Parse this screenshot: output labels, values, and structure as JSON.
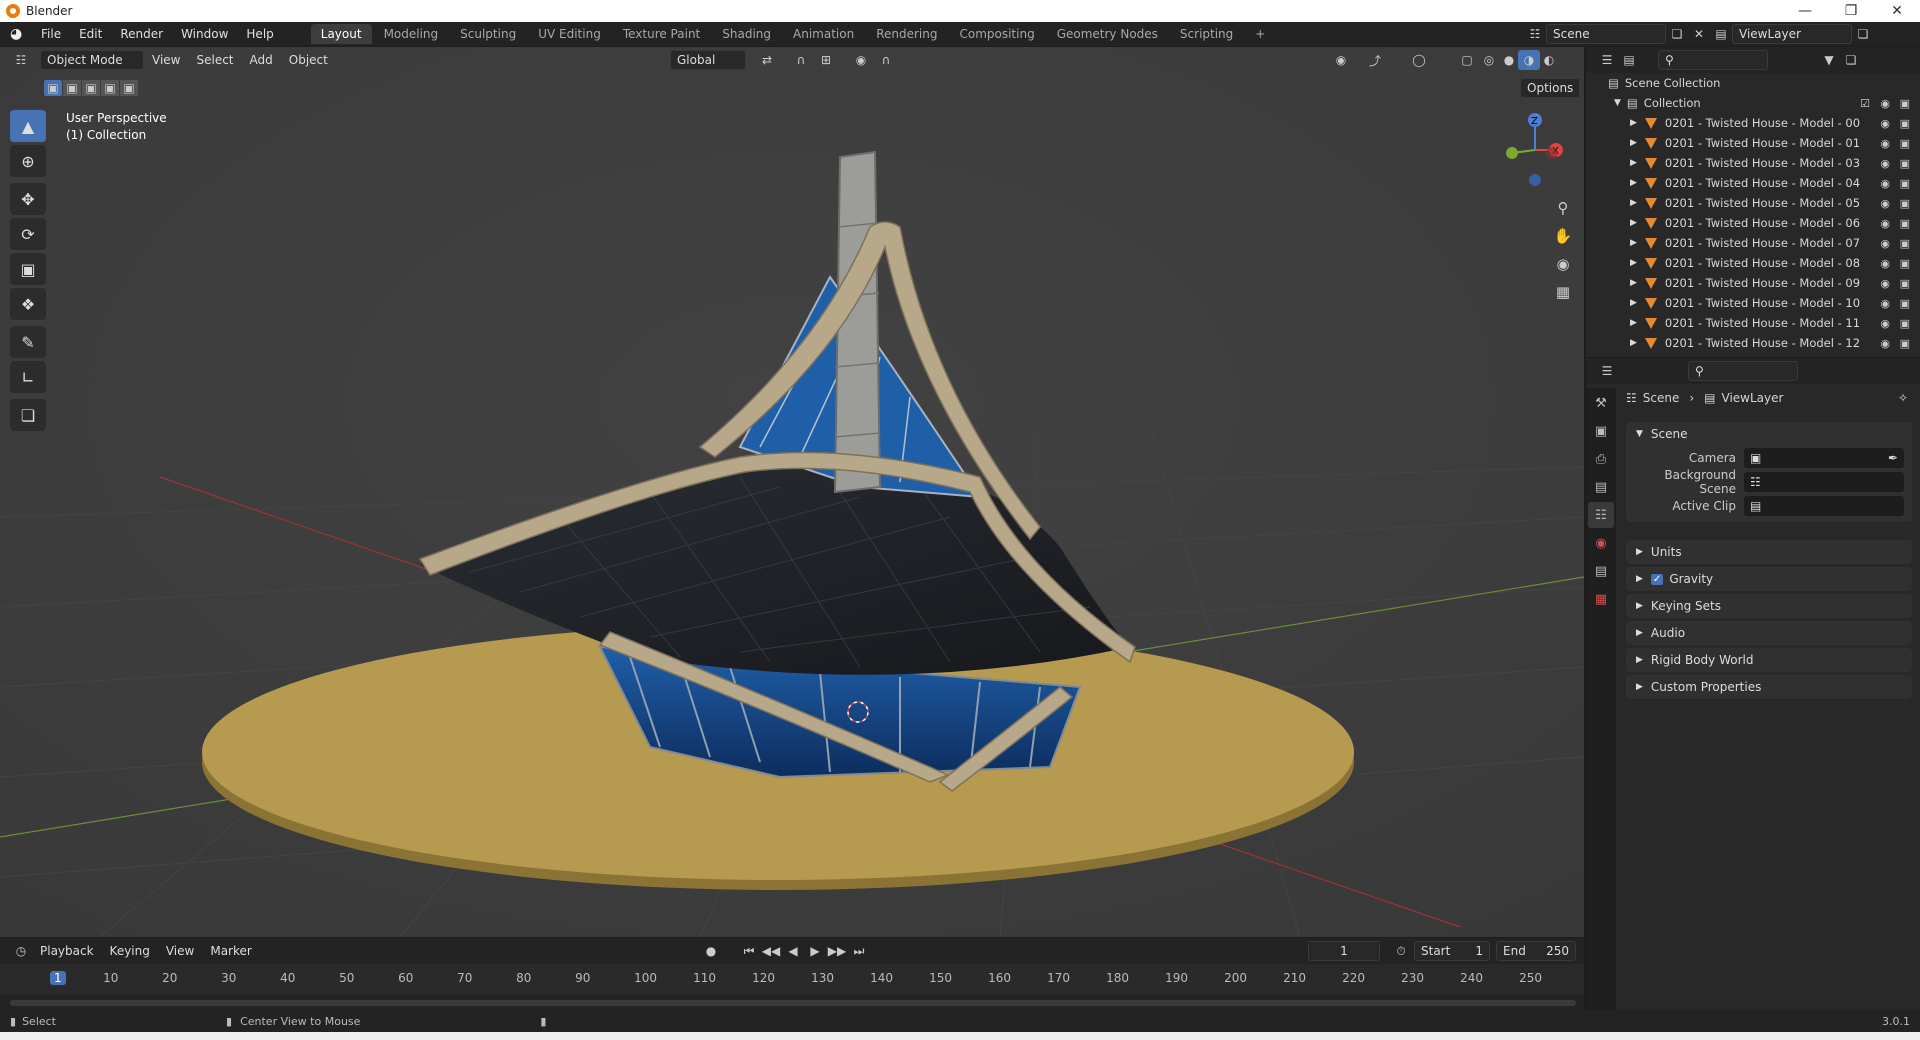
{
  "window": {
    "title": "Blender"
  },
  "menu": [
    "File",
    "Edit",
    "Render",
    "Window",
    "Help"
  ],
  "workspaces": [
    "Layout",
    "Modeling",
    "Sculpting",
    "UV Editing",
    "Texture Paint",
    "Shading",
    "Animation",
    "Rendering",
    "Compositing",
    "Geometry Nodes",
    "Scripting",
    "+"
  ],
  "scene_field": "Scene",
  "viewlayer_field": "ViewLayer",
  "viewport": {
    "mode": "Object Mode",
    "menus": [
      "View",
      "Select",
      "Add",
      "Object"
    ],
    "transform": "Global",
    "options": "Options",
    "overlay_line1": "User Perspective",
    "overlay_line2": "(1) Collection"
  },
  "outliner": {
    "scene_collection": "Scene Collection",
    "collection": "Collection",
    "items": [
      "0201 - Twisted House - Model - 00",
      "0201 - Twisted House - Model - 01",
      "0201 - Twisted House - Model - 03",
      "0201 - Twisted House - Model - 04",
      "0201 - Twisted House - Model - 05",
      "0201 - Twisted House - Model - 06",
      "0201 - Twisted House - Model - 07",
      "0201 - Twisted House - Model - 08",
      "0201 - Twisted House - Model - 09",
      "0201 - Twisted House - Model - 10",
      "0201 - Twisted House - Model - 11",
      "0201 - Twisted House - Model - 12"
    ]
  },
  "properties": {
    "breadcrumb_scene": "Scene",
    "breadcrumb_viewlayer": "ViewLayer",
    "panel_scene": "Scene",
    "camera_label": "Camera",
    "bg_scene_label": "Background Scene",
    "active_clip_label": "Active Clip",
    "sections": [
      "Units",
      "Gravity",
      "Keying Sets",
      "Audio",
      "Rigid Body World",
      "Custom Properties"
    ]
  },
  "timeline": {
    "menus": [
      "Playback",
      "Keying",
      "View",
      "Marker"
    ],
    "current_frame": "1",
    "start_label": "Start",
    "start_value": "1",
    "end_label": "End",
    "end_value": "250",
    "ticks": [
      "1",
      "10",
      "20",
      "30",
      "40",
      "50",
      "60",
      "70",
      "80",
      "90",
      "100",
      "110",
      "120",
      "130",
      "140",
      "150",
      "160",
      "170",
      "180",
      "190",
      "200",
      "210",
      "220",
      "230",
      "240",
      "250"
    ]
  },
  "status": {
    "select": "Select",
    "center_view": "Center View to Mouse",
    "version": "3.0.1"
  }
}
